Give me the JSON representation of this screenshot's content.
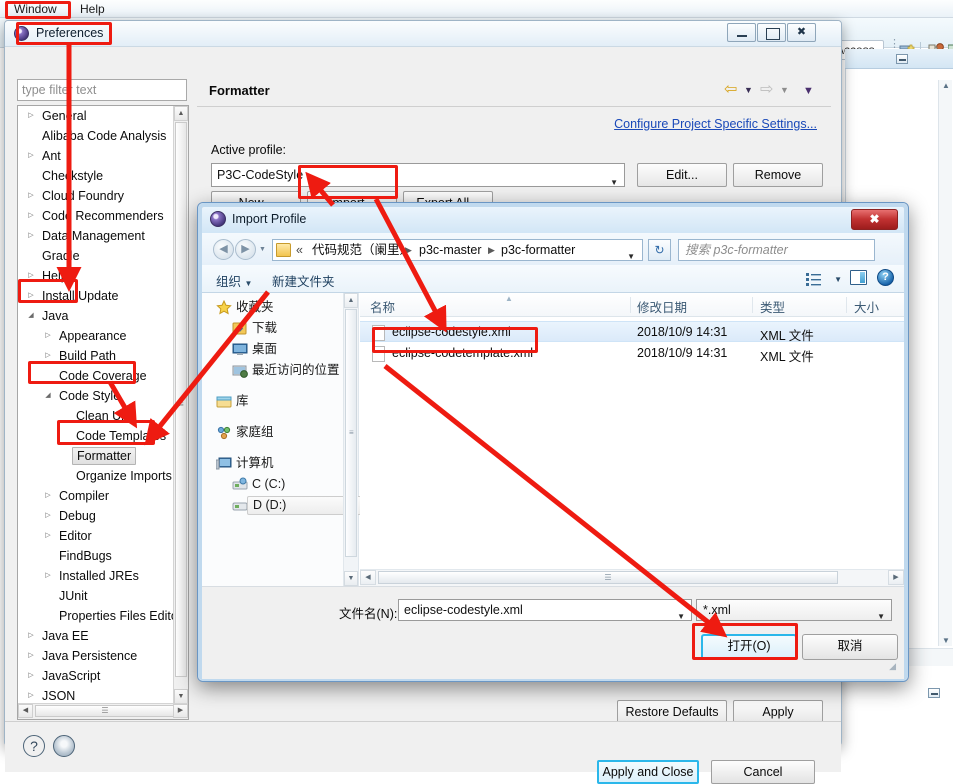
{
  "accent": {
    "red_annotation": "#ee1b11",
    "link_blue": "#1a49b8",
    "focus_blue": "#2bb7ea"
  },
  "eclipse": {
    "menubar": [
      {
        "label": "Window",
        "highlighted": true
      },
      {
        "label": "Help",
        "highlighted": false
      }
    ],
    "quick_access": "Access",
    "toolbar_icons": [
      "new-wizard-icon",
      "package-explorer-icon",
      "java-perspective-icon"
    ]
  },
  "preferences": {
    "title": "Preferences",
    "title_icon": "eclipse-preferences-icon",
    "window_buttons": {
      "minimize": "minimize-icon",
      "maximize": "maximize-icon",
      "close": "✖"
    },
    "filter_placeholder": "type filter text",
    "tree": [
      {
        "label": "General",
        "indent": 0,
        "twisty": "collapsed"
      },
      {
        "label": "Alibaba Code Analysis",
        "indent": 0,
        "twisty": "none"
      },
      {
        "label": "Ant",
        "indent": 0,
        "twisty": "collapsed"
      },
      {
        "label": "Checkstyle",
        "indent": 0,
        "twisty": "none"
      },
      {
        "label": "Cloud Foundry",
        "indent": 0,
        "twisty": "collapsed"
      },
      {
        "label": "Code Recommenders",
        "indent": 0,
        "twisty": "collapsed"
      },
      {
        "label": "Data Management",
        "indent": 0,
        "twisty": "collapsed"
      },
      {
        "label": "Gradle",
        "indent": 0,
        "twisty": "none"
      },
      {
        "label": "Help",
        "indent": 0,
        "twisty": "collapsed"
      },
      {
        "label": "Install/Update",
        "indent": 0,
        "twisty": "collapsed"
      },
      {
        "label": "Java",
        "indent": 0,
        "twisty": "expanded"
      },
      {
        "label": "Appearance",
        "indent": 1,
        "twisty": "collapsed"
      },
      {
        "label": "Build Path",
        "indent": 1,
        "twisty": "collapsed"
      },
      {
        "label": "Code Coverage",
        "indent": 1,
        "twisty": "none"
      },
      {
        "label": "Code Style",
        "indent": 1,
        "twisty": "expanded"
      },
      {
        "label": "Clean Up",
        "indent": 2,
        "twisty": "none"
      },
      {
        "label": "Code Templates",
        "indent": 2,
        "twisty": "none"
      },
      {
        "label": "Formatter",
        "indent": 2,
        "twisty": "none",
        "selected": true
      },
      {
        "label": "Organize Imports",
        "indent": 2,
        "twisty": "none"
      },
      {
        "label": "Compiler",
        "indent": 1,
        "twisty": "collapsed"
      },
      {
        "label": "Debug",
        "indent": 1,
        "twisty": "collapsed"
      },
      {
        "label": "Editor",
        "indent": 1,
        "twisty": "collapsed"
      },
      {
        "label": "FindBugs",
        "indent": 1,
        "twisty": "none"
      },
      {
        "label": "Installed JREs",
        "indent": 1,
        "twisty": "collapsed"
      },
      {
        "label": "JUnit",
        "indent": 1,
        "twisty": "none"
      },
      {
        "label": "Properties Files Editor",
        "indent": 1,
        "twisty": "none"
      },
      {
        "label": "Java EE",
        "indent": 0,
        "twisty": "collapsed"
      },
      {
        "label": "Java Persistence",
        "indent": 0,
        "twisty": "collapsed"
      },
      {
        "label": "JavaScript",
        "indent": 0,
        "twisty": "collapsed"
      },
      {
        "label": "JSON",
        "indent": 0,
        "twisty": "collapsed"
      }
    ],
    "pane": {
      "title": "Formatter",
      "nav_back_icon": "back-arrow-icon",
      "nav_forward_icon": "forward-arrow-icon",
      "nav_menu_icon": "chevron-down-icon",
      "configure_link": "Configure Project Specific Settings...",
      "active_profile_label": "Active profile:",
      "active_profile_value": "P3C-CodeStyle",
      "buttons": {
        "edit": "Edit...",
        "remove": "Remove",
        "new": "New...",
        "import": "Import...",
        "export_all": "Export All...",
        "restore_defaults": "Restore Defaults",
        "apply": "Apply"
      }
    },
    "footer": {
      "help_icon": "question-mark-icon",
      "shell_icon": "shell-circle-icon",
      "apply_and_close": "Apply and Close",
      "cancel": "Cancel"
    }
  },
  "import_dialog": {
    "title": "Import Profile",
    "title_icon": "eclipse-preferences-icon",
    "close_label": "✖",
    "nav": {
      "back_icon": "nav-back-icon",
      "forward_icon": "nav-forward-icon",
      "history_icon": "chevron-down-icon",
      "breadcrumb_prefix": "«",
      "breadcrumbs": [
        "代码规范（阑里）",
        "p3c-master",
        "p3c-formatter"
      ],
      "refresh_icon": "refresh-icon",
      "search_placeholder": "搜索 p3c-formatter",
      "search_icon": "search-icon"
    },
    "toolbar": {
      "organize": "组织",
      "new_folder": "新建文件夹",
      "view_icon": "view-list-icon",
      "preview_pane_icon": "preview-pane-icon",
      "help_icon": "help-circle-icon"
    },
    "places": [
      {
        "label": "收藏夹",
        "icon": "star-icon",
        "indent": 0
      },
      {
        "label": "下载",
        "icon": "downloads-icon",
        "indent": 1
      },
      {
        "label": "桌面",
        "icon": "desktop-icon",
        "indent": 1
      },
      {
        "label": "最近访问的位置",
        "icon": "recent-places-icon",
        "indent": 1
      },
      {
        "label": "",
        "icon": "",
        "indent": 0
      },
      {
        "label": "库",
        "icon": "library-icon",
        "indent": 0
      },
      {
        "label": "",
        "icon": "",
        "indent": 0
      },
      {
        "label": "家庭组",
        "icon": "homegroup-icon",
        "indent": 0
      },
      {
        "label": "",
        "icon": "",
        "indent": 0
      },
      {
        "label": "计算机",
        "icon": "computer-icon",
        "indent": 0
      },
      {
        "label": "C (C:)",
        "icon": "system-drive-icon",
        "indent": 1
      },
      {
        "label": "D (D:)",
        "icon": "drive-icon",
        "indent": 1,
        "selected": true
      }
    ],
    "columns": [
      "名称",
      "修改日期",
      "类型",
      "大小"
    ],
    "files": [
      {
        "name": "eclipse-codestyle.xml",
        "date": "2018/10/9 14:31",
        "type": "XML 文件",
        "size": "",
        "selected": true
      },
      {
        "name": "eclipse-codetemplate.xml",
        "date": "2018/10/9 14:31",
        "type": "XML 文件",
        "size": "",
        "selected": false
      }
    ],
    "footer": {
      "filename_label": "文件名(N):",
      "filename_value": "eclipse-codestyle.xml",
      "filetype_value": "*.xml",
      "open_button": "打开(O)",
      "cancel_button": "取消"
    }
  },
  "annotations": {
    "boxes": [
      "window-menu-box",
      "preferences-box",
      "java-tree-box",
      "code-style-tree-box",
      "formatter-tree-box",
      "import-button-box",
      "codestyle-file-box",
      "open-button-box"
    ],
    "arrows": [
      "preferences-to-java",
      "code-style-to-formatter",
      "import-to-dialog",
      "dialog-to-codestyle-file",
      "codestyle-file-to-formatter",
      "codestyle-file-to-open"
    ]
  }
}
